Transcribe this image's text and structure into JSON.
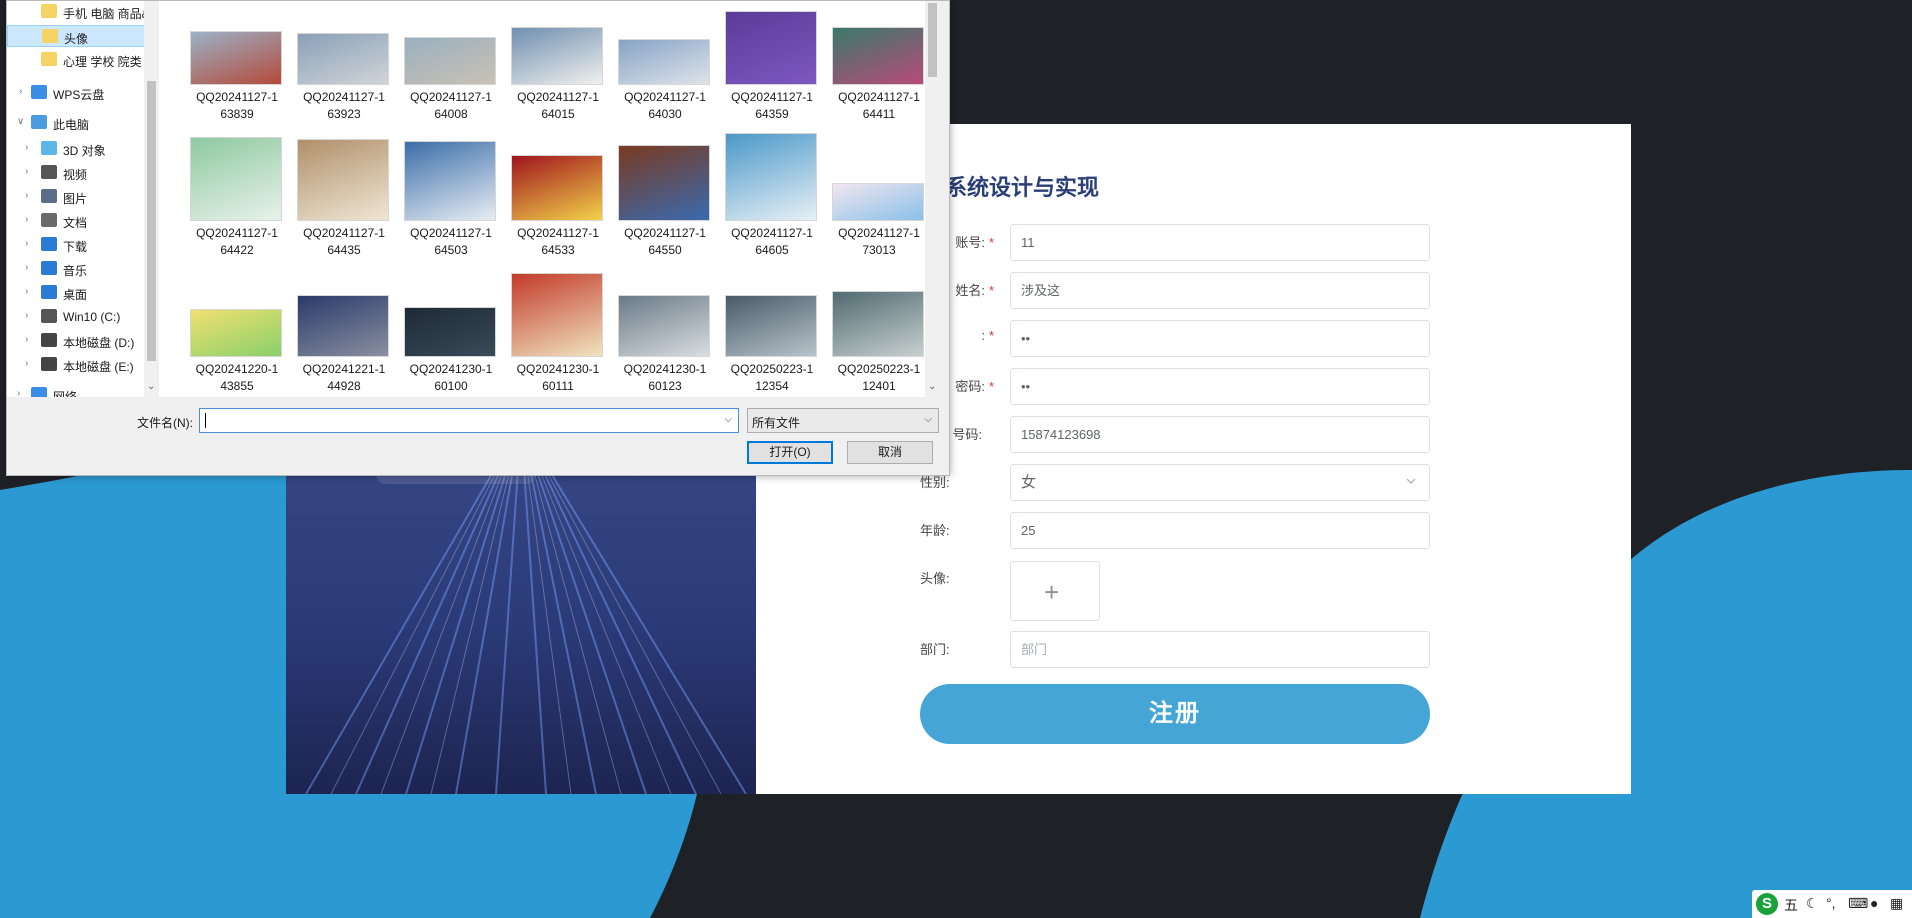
{
  "registration": {
    "title": "乡镇卫生所医用物资进销存系统设计与实现",
    "fields": [
      {
        "label": "账号:",
        "required": true,
        "value": "11"
      },
      {
        "label": "姓名:",
        "required": true,
        "value": "涉及这"
      },
      {
        "label": ":",
        "required": true,
        "value": "••"
      },
      {
        "label": "密码:",
        "required": true,
        "value": "••"
      },
      {
        "label": "号码:",
        "required": false,
        "value": "15874123698"
      },
      {
        "label": "性别:",
        "required": false,
        "value": "女"
      },
      {
        "label": "年龄:",
        "required": false,
        "value": "25"
      },
      {
        "label": "头像:",
        "required": false,
        "value": ""
      },
      {
        "label": "部门:",
        "required": false,
        "value": "",
        "placeholder": "部门"
      }
    ],
    "avatar_plus": "+",
    "submit_label": "注册"
  },
  "dialog": {
    "nav": [
      {
        "label": "手机 电脑 商品&",
        "icon": "folder-icon"
      },
      {
        "label": "头像",
        "icon": "folder-icon",
        "selected": true
      },
      {
        "label": "心理 学校 院类",
        "icon": "folder-icon"
      },
      {
        "label": "WPS云盘",
        "icon": "cloud-icon"
      },
      {
        "label": "此电脑",
        "icon": "computer-icon"
      },
      {
        "label": "3D 对象",
        "icon": "cube-icon"
      },
      {
        "label": "视频",
        "icon": "video-icon"
      },
      {
        "label": "图片",
        "icon": "picture-icon"
      },
      {
        "label": "文档",
        "icon": "document-icon"
      },
      {
        "label": "下载",
        "icon": "download-icon"
      },
      {
        "label": "音乐",
        "icon": "music-icon"
      },
      {
        "label": "桌面",
        "icon": "desktop-icon"
      },
      {
        "label": "Win10 (C:)",
        "icon": "windows-drive-icon"
      },
      {
        "label": "本地磁盘 (D:)",
        "icon": "drive-icon"
      },
      {
        "label": "本地磁盘 (E:)",
        "icon": "drive-icon"
      },
      {
        "label": "网络",
        "icon": "network-icon"
      }
    ],
    "files": [
      {
        "line1": "QQ20241127-1",
        "line2": "63839"
      },
      {
        "line1": "QQ20241127-1",
        "line2": "63923"
      },
      {
        "line1": "QQ20241127-1",
        "line2": "64008"
      },
      {
        "line1": "QQ20241127-1",
        "line2": "64015"
      },
      {
        "line1": "QQ20241127-1",
        "line2": "64030"
      },
      {
        "line1": "QQ20241127-1",
        "line2": "64359"
      },
      {
        "line1": "QQ20241127-1",
        "line2": "64411"
      },
      {
        "line1": "QQ20241127-1",
        "line2": "64422"
      },
      {
        "line1": "QQ20241127-1",
        "line2": "64435"
      },
      {
        "line1": "QQ20241127-1",
        "line2": "64503"
      },
      {
        "line1": "QQ20241127-1",
        "line2": "64533"
      },
      {
        "line1": "QQ20241127-1",
        "line2": "64550"
      },
      {
        "line1": "QQ20241127-1",
        "line2": "64605"
      },
      {
        "line1": "QQ20241127-1",
        "line2": "73013"
      },
      {
        "line1": "QQ20241220-1",
        "line2": "43855"
      },
      {
        "line1": "QQ20241221-1",
        "line2": "44928"
      },
      {
        "line1": "QQ20241230-1",
        "line2": "60100"
      },
      {
        "line1": "QQ20241230-1",
        "line2": "60111"
      },
      {
        "line1": "QQ20241230-1",
        "line2": "60123"
      },
      {
        "line1": "QQ20250223-1",
        "line2": "12354"
      },
      {
        "line1": "QQ20250223-1",
        "line2": "12401"
      }
    ],
    "filename_label": "文件名(N):",
    "filename_value": "",
    "filetype_value": "所有文件",
    "open_label": "打开(O)",
    "cancel_label": "取消"
  },
  "tray": {
    "ime_mode": "五",
    "logo": "S"
  }
}
